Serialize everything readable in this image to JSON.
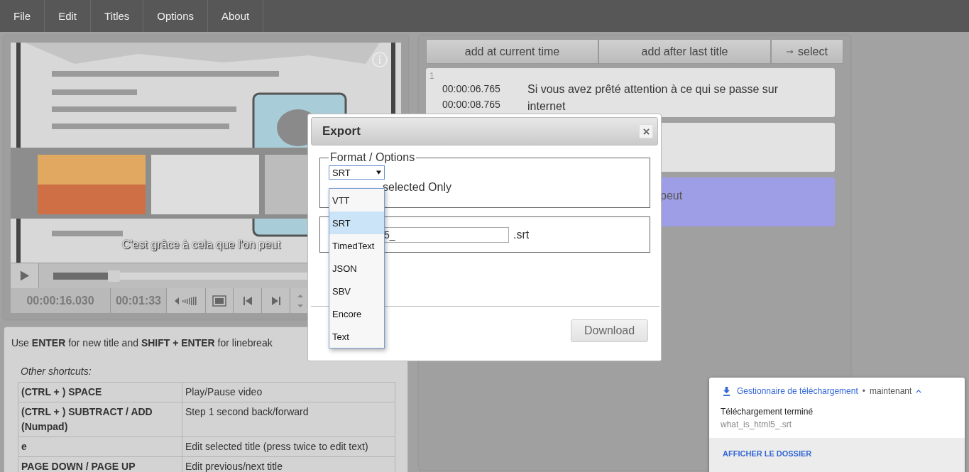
{
  "menu": [
    {
      "label": "File"
    },
    {
      "label": "Edit"
    },
    {
      "label": "Titles"
    },
    {
      "label": "Options"
    },
    {
      "label": "About"
    }
  ],
  "player": {
    "subtitle": "C'est grâce à cela que l'on peut",
    "progress": {
      "level": 0.16
    },
    "current_time": "00:00:16.030",
    "duration": "00:01:33"
  },
  "help": {
    "intro": "Use **ENTER** for new title and **SHIFT + ENTER** for linebreak",
    "shortcuts_heading": "Other shortcuts:",
    "shortcuts": [
      {
        "keys": "(CTRL + ) SPACE",
        "action": "Play/Pause video"
      },
      {
        "keys": "(CTRL + ) SUBTRACT / ADD (Numpad)",
        "action": "Step 1 second back/forward"
      },
      {
        "keys": "e",
        "action": "Edit selected title (press twice to edit text)"
      },
      {
        "keys": "PAGE DOWN / PAGE UP",
        "action": "Edit previous/next title"
      }
    ]
  },
  "toolbar": [
    {
      "label": "add at current time",
      "kind": "plain"
    },
    {
      "label": "add after last title",
      "kind": "plain"
    },
    {
      "label": "select",
      "kind": "arrow"
    }
  ],
  "titles": [
    {
      "index": "1",
      "start": "00:00:06.765",
      "end": "00:00:08.765",
      "text": "Si vous avez prêté attention à ce qui se passe sur internet",
      "selected": false
    },
    {
      "selected": false
    },
    {
      "text": "peut",
      "selected": true
    }
  ],
  "export_dialog": {
    "title": "Export",
    "fieldset": "Format / Options",
    "format": "SRT",
    "options": [
      {
        "label": "VTT",
        "selected": false
      },
      {
        "label": "SRT",
        "selected": true
      },
      {
        "label": "TimedText",
        "selected": false
      },
      {
        "label": "JSON",
        "selected": false
      },
      {
        "label": "SBV",
        "selected": false
      },
      {
        "label": "Encore",
        "selected": false
      },
      {
        "label": "Text",
        "selected": false
      }
    ],
    "selected_only_label": "selected Only",
    "filename": "5_",
    "extension": ".srt",
    "download": "Download"
  },
  "notification": {
    "source": "Gestionnaire de téléchargement",
    "separator": "•",
    "time": "maintenant",
    "title": "Téléchargement terminé",
    "file": "what_is_html5_.srt",
    "action": "AFFICHER LE DOSSIER"
  }
}
